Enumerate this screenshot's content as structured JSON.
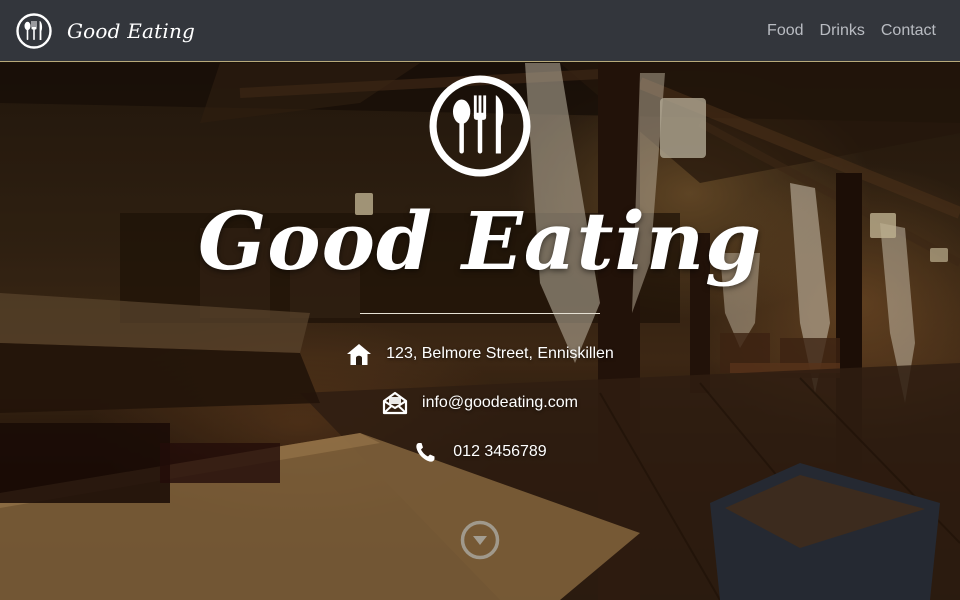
{
  "navbar": {
    "brand_name": "Good Eating",
    "links": [
      "Food",
      "Drinks",
      "Contact"
    ]
  },
  "hero": {
    "title": "Good Eating",
    "address": "123, Belmore Street, Enniskillen",
    "email": "info@goodeating.com",
    "phone": "012 3456789"
  },
  "icons": {
    "brand": "cutlery-icon",
    "hero": "cutlery-icon",
    "address": "home-icon",
    "email": "envelope-open-icon",
    "phone": "phone-icon",
    "scroll": "chevron-down-circle-icon"
  },
  "colors": {
    "navbar_bg": "#33363c",
    "nav_link": "#b9bcc2",
    "navbar_border": "#b8a97a",
    "text": "#ffffff"
  }
}
